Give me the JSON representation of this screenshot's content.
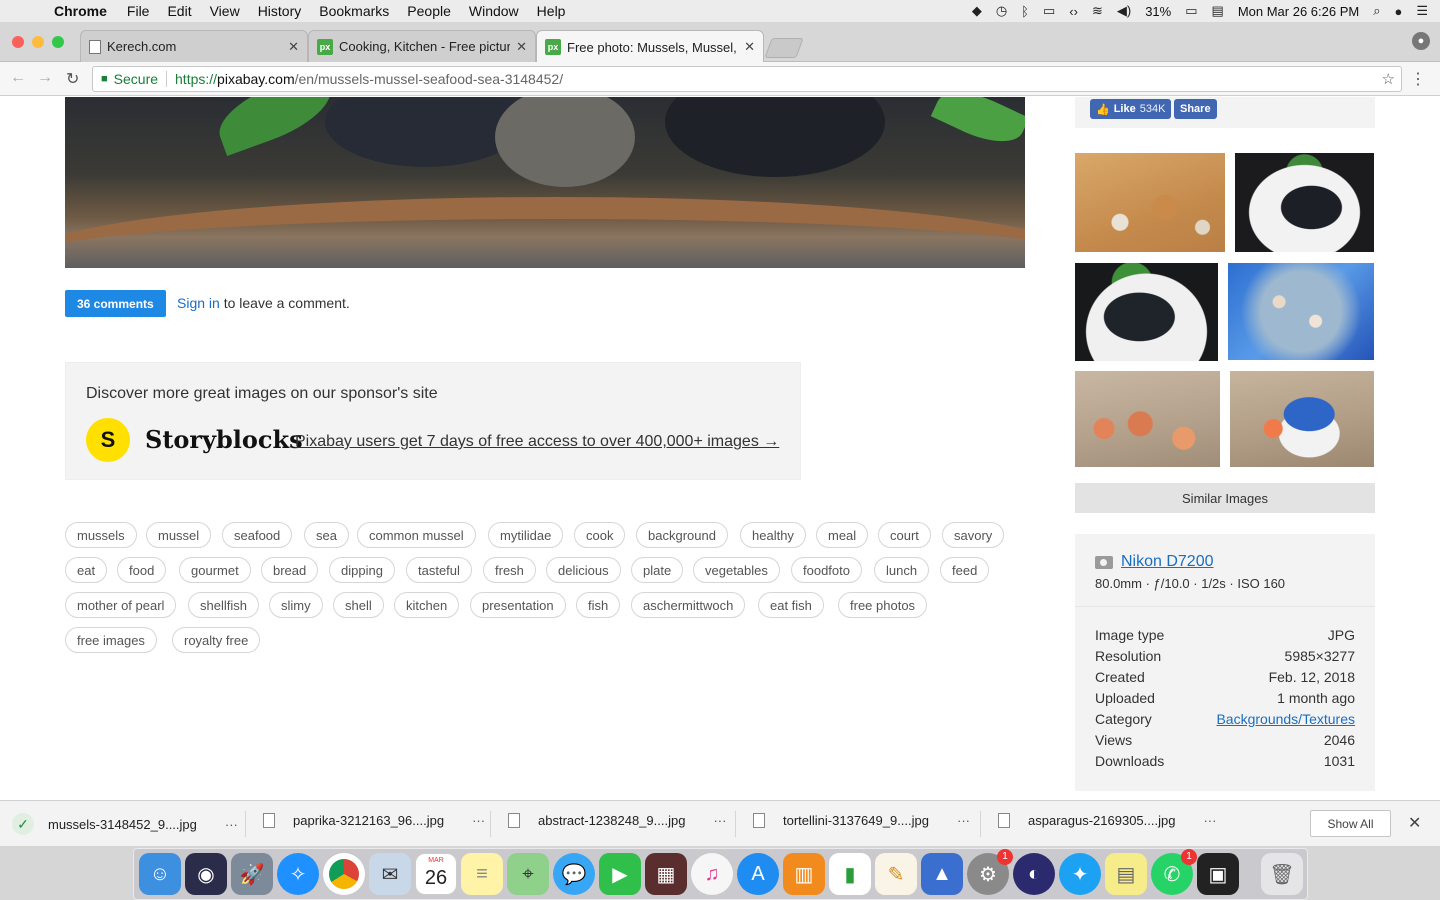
{
  "menubar": {
    "app": "Chrome",
    "items": [
      "File",
      "Edit",
      "View",
      "History",
      "Bookmarks",
      "People",
      "Window",
      "Help"
    ],
    "battery": "31%",
    "datetime": "Mon Mar 26  6:26 PM"
  },
  "tabs": [
    {
      "title": "Kerech.com",
      "favicon": "doc"
    },
    {
      "title": "Cooking, Kitchen - Free pictur",
      "favicon": "px"
    },
    {
      "title": "Free photo: Mussels, Mussel, S",
      "favicon": "px",
      "active": true
    }
  ],
  "address": {
    "secure_label": "Secure",
    "scheme": "https://",
    "host": "pixabay.com",
    "path": "/en/mussels-mussel-seafood-sea-3148452/"
  },
  "social": {
    "like_label": "Like",
    "like_count": "534K",
    "share_label": "Share"
  },
  "comments": {
    "button": "36 comments",
    "signin_link": "Sign in",
    "signin_rest": " to leave a comment."
  },
  "sponsor": {
    "heading": "Discover more great images on our sponsor's site",
    "logo_letter": "S",
    "brand": "Storyblocks",
    "offer": "Pixabay users get 7 days of free access to over 400,000+ images →"
  },
  "tags": [
    "mussels",
    "mussel",
    "seafood",
    "sea",
    "common mussel",
    "mytilidae",
    "cook",
    "background",
    "healthy",
    "meal",
    "court",
    "savory",
    "eat",
    "food",
    "gourmet",
    "bread",
    "dipping",
    "tasteful",
    "fresh",
    "delicious",
    "plate",
    "vegetables",
    "foodfoto",
    "lunch",
    "feed",
    "mother of pearl",
    "shellfish",
    "slimy",
    "shell",
    "kitchen",
    "presentation",
    "fish",
    "aschermittwoch",
    "eat fish",
    "free photos",
    "free images",
    "royalty free"
  ],
  "similar_button": "Similar Images",
  "camera": {
    "name": "Nikon D7200",
    "settings": "80.0mm · ƒ/10.0 · 1/2s · ISO 160"
  },
  "details": [
    {
      "label": "Image type",
      "value": "JPG"
    },
    {
      "label": "Resolution",
      "value": "5985×3277"
    },
    {
      "label": "Created",
      "value": "Feb. 12, 2018"
    },
    {
      "label": "Uploaded",
      "value": "1 month ago"
    },
    {
      "label": "Category",
      "value": "Backgrounds/Textures",
      "link": true
    },
    {
      "label": "Views",
      "value": "2046"
    },
    {
      "label": "Downloads",
      "value": "1031"
    }
  ],
  "downloads": {
    "items": [
      "mussels-3148452_9....jpg",
      "paprika-3212163_96....jpg",
      "abstract-1238248_9....jpg",
      "tortellini-3137649_9....jpg",
      "asparagus-2169305....jpg"
    ],
    "dots": "···",
    "show_all": "Show All"
  },
  "dock": {
    "calendar_month": "MAR",
    "calendar_day": "26",
    "badge": "1"
  },
  "colors": {
    "accent": "#1e88e5",
    "link": "#1a6ec2",
    "facebook": "#4267b2",
    "secure_green": "#188038"
  }
}
